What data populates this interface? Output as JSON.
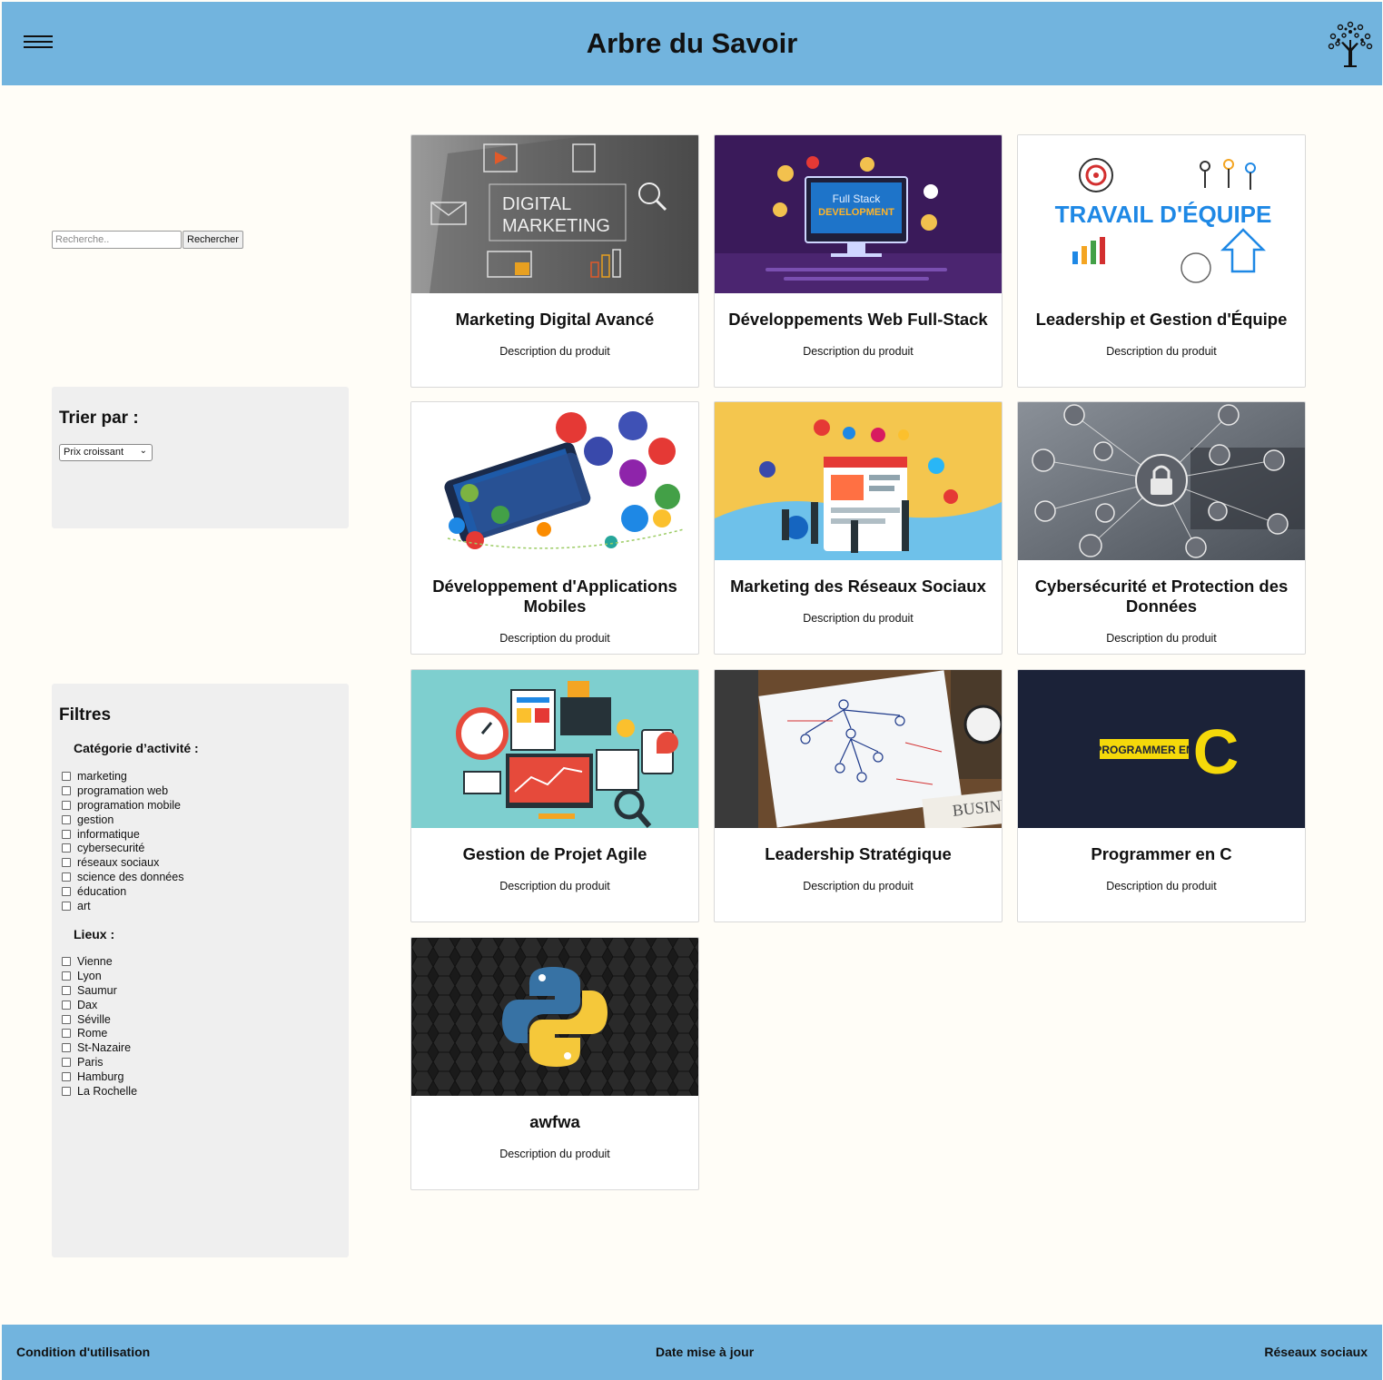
{
  "header": {
    "title": "Arbre du Savoir",
    "menu_icon": "hamburger-menu-icon",
    "logo_icon": "tree-logo-icon"
  },
  "search": {
    "placeholder": "Recherche..",
    "button_label": "Rechercher"
  },
  "sort": {
    "heading": "Trier par :",
    "selected": "Prix croissant"
  },
  "filters": {
    "heading": "Filtres",
    "category_heading": "Catégorie d’activité :",
    "categories": [
      "marketing",
      "programation web",
      "programation mobile",
      "gestion",
      "informatique",
      "cybersecurité",
      "réseaux sociaux",
      "science des données",
      "éducation",
      "art"
    ],
    "places_heading": "Lieux :",
    "places": [
      "Vienne",
      "Lyon",
      "Saumur",
      "Dax",
      "Séville",
      "Rome",
      "St-Nazaire",
      "Paris",
      "Hamburg",
      "La Rochelle"
    ]
  },
  "products": [
    {
      "title": "Marketing Digital Avancé",
      "description": "Description du produit",
      "image": {
        "kind": "digital-marketing",
        "text": [
          "DIGITAL",
          "MARKETING"
        ]
      }
    },
    {
      "title": "Développements Web Full-Stack",
      "description": "Description du produit",
      "image": {
        "kind": "full-stack",
        "text": [
          "Full Stack",
          "DEVELOPMENT"
        ]
      }
    },
    {
      "title": "Leadership et Gestion d'Équipe",
      "description": "Description du produit",
      "image": {
        "kind": "travail-equipe",
        "text": [
          "TRAVAIL D'ÉQUIPE"
        ]
      }
    },
    {
      "title": "Développement d'Applications Mobiles",
      "description": "Description du produit",
      "image": {
        "kind": "mobile-apps",
        "text": []
      }
    },
    {
      "title": "Marketing des Réseaux Sociaux",
      "description": "Description du produit",
      "image": {
        "kind": "social-media",
        "text": []
      }
    },
    {
      "title": "Cybersécurité et Protection des Données",
      "description": "Description du produit",
      "image": {
        "kind": "cybersecurity",
        "text": []
      }
    },
    {
      "title": "Gestion de Projet Agile",
      "description": "Description du produit",
      "image": {
        "kind": "agile",
        "text": []
      }
    },
    {
      "title": "Leadership Stratégique",
      "description": "Description du produit",
      "image": {
        "kind": "strategy",
        "text": [
          "BUSINE"
        ]
      }
    },
    {
      "title": "Programmer en C",
      "description": "Description du produit",
      "image": {
        "kind": "c-language",
        "text": [
          "PROGRAMMER EN",
          "C"
        ]
      }
    },
    {
      "title": "awfwa",
      "description": "Description du produit",
      "image": {
        "kind": "python",
        "text": []
      }
    }
  ],
  "footer": {
    "terms": "Condition d'utilisation",
    "updated": "Date mise à jour",
    "social": "Réseaux sociaux"
  },
  "colors": {
    "header_bg": "#72b4de",
    "page_bg": "#fffdf7",
    "panel_bg": "#efefef"
  }
}
